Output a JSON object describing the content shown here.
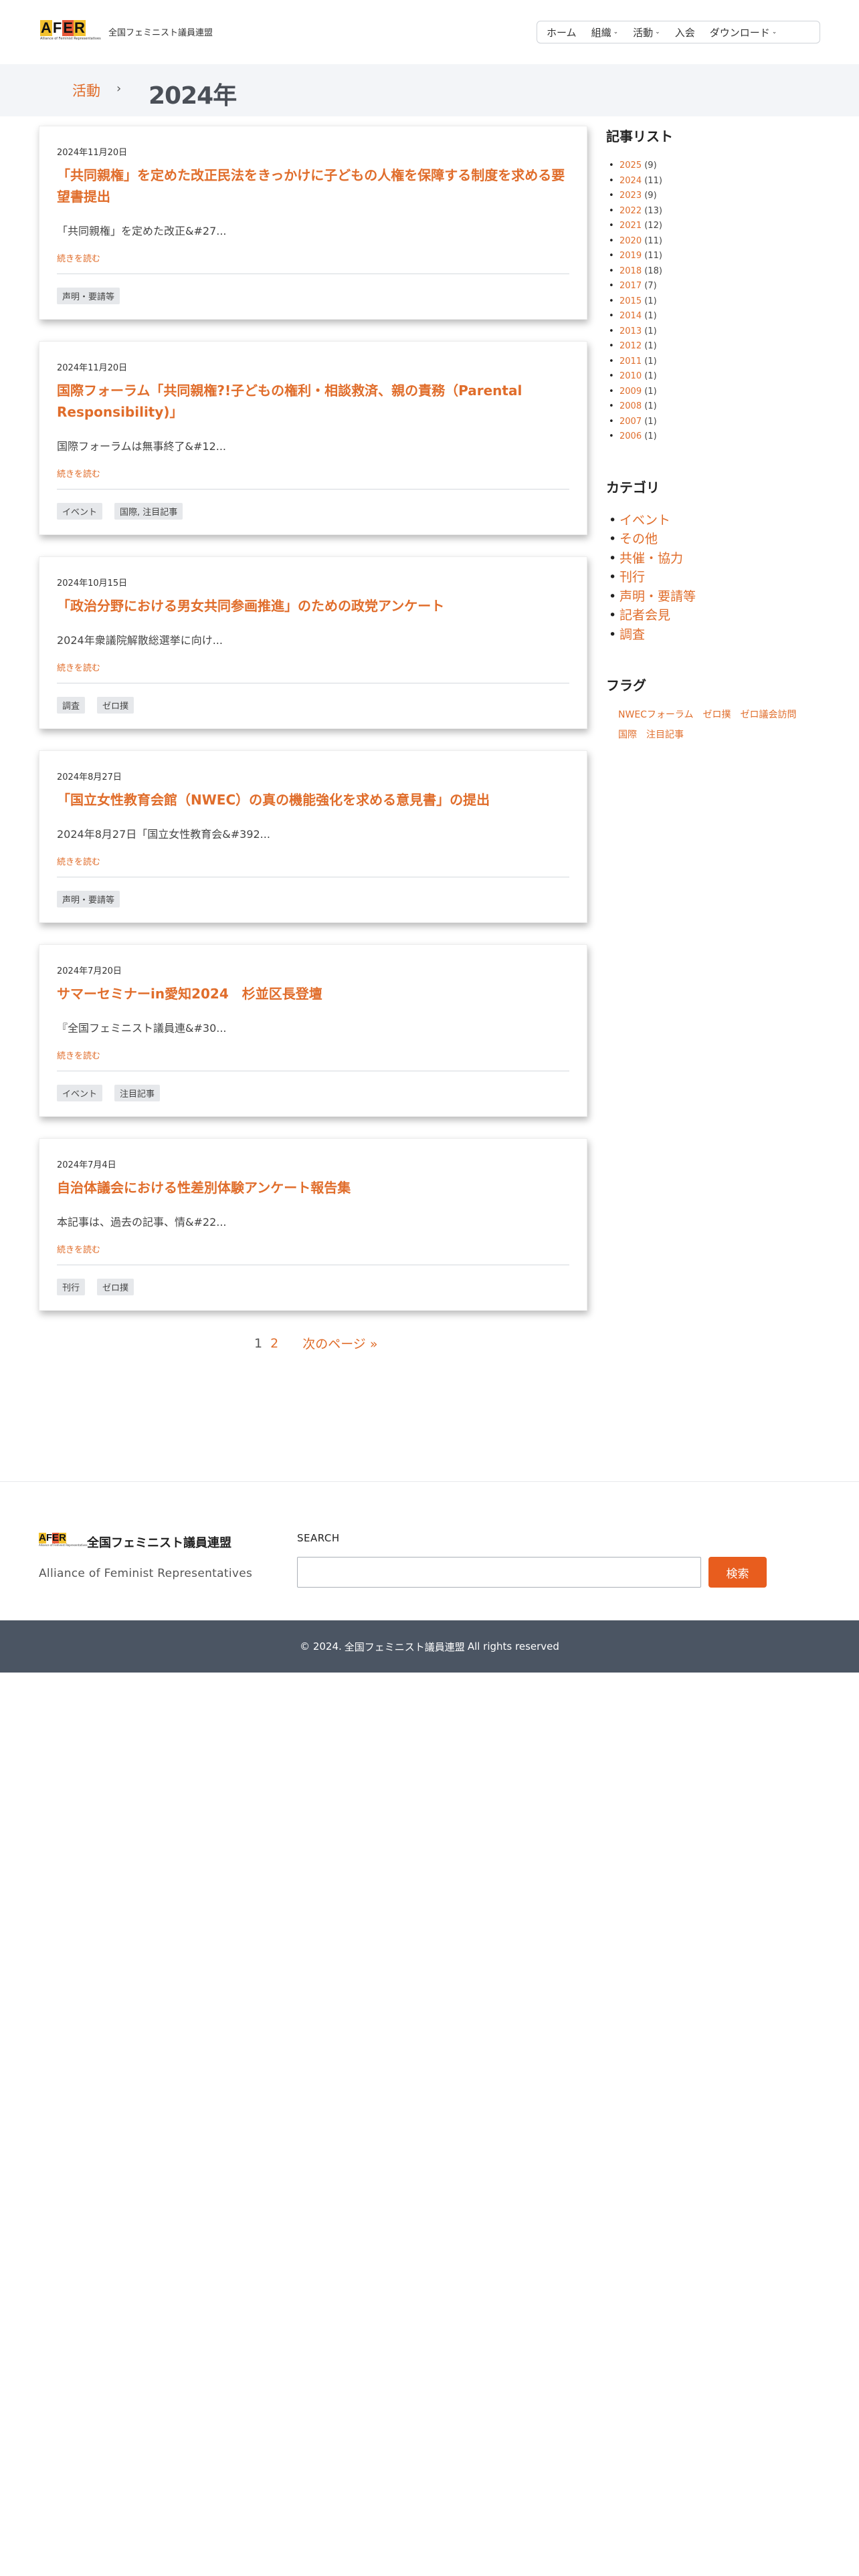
{
  "header": {
    "logo_text": [
      "A",
      "F",
      "E",
      "R"
    ],
    "logo_subtext": "Alliance of Feminist Representatives",
    "site_name": "全国フェミニスト議員連盟",
    "nav": [
      {
        "label": "ホーム",
        "has_dropdown": false
      },
      {
        "label": "組織",
        "has_dropdown": true
      },
      {
        "label": "活動",
        "has_dropdown": true
      },
      {
        "label": "入会",
        "has_dropdown": false
      },
      {
        "label": "ダウンロード",
        "has_dropdown": true
      }
    ]
  },
  "breadcrumb": {
    "parent": "活動",
    "separator": "›",
    "current": "2024年"
  },
  "posts": [
    {
      "date": "2024年11月20日",
      "title": "「共同親権」を定めた改正民法をきっかけに子どもの人権を保障する制度を求める要望書提出",
      "excerpt": "「共同親権」を定めた改正&#27...",
      "read_more": "続きを読む",
      "tags": [
        "声明・要請等"
      ]
    },
    {
      "date": "2024年11月20日",
      "title": "国際フォーラム「共同親権?!子どもの権利・相談救済、親の責務（Parental Responsibility)」",
      "excerpt": "国際フォーラムは無事終了&#12...",
      "read_more": "続きを読む",
      "tags": [
        "イベント",
        "国際, 注目記事"
      ]
    },
    {
      "date": "2024年10月15日",
      "title": "「政治分野における男女共同参画推進」のための政党アンケート",
      "excerpt": "2024年衆議院解散総選挙に向け...",
      "read_more": "続きを読む",
      "tags": [
        "調査",
        "ゼロ撲"
      ]
    },
    {
      "date": "2024年8月27日",
      "title": "「国立女性教育会館（NWEC）の真の機能強化を求める意見書」の提出",
      "excerpt": "2024年8月27日「国立女性教育会&#392...",
      "read_more": "続きを読む",
      "tags": [
        "声明・要請等"
      ]
    },
    {
      "date": "2024年7月20日",
      "title": "サマーセミナーin愛知2024　杉並区長登壇",
      "excerpt": "『全国フェミニスト議員連&#30...",
      "read_more": "続きを読む",
      "tags": [
        "イベント",
        "注目記事"
      ]
    },
    {
      "date": "2024年7月4日",
      "title": "自治体議会における性差別体験アンケート報告集",
      "excerpt": "本記事は、過去の記事、情&#22...",
      "read_more": "続きを読む",
      "tags": [
        "刊行",
        "ゼロ撲"
      ]
    }
  ],
  "pagination": {
    "current": "1",
    "pages": [
      "2"
    ],
    "next": "次のページ »"
  },
  "sidebar": {
    "archive_title": "記事リスト",
    "archives": [
      {
        "year": "2025",
        "count": "(9)"
      },
      {
        "year": "2024",
        "count": "(11)"
      },
      {
        "year": "2023",
        "count": "(9)"
      },
      {
        "year": "2022",
        "count": "(13)"
      },
      {
        "year": "2021",
        "count": "(12)"
      },
      {
        "year": "2020",
        "count": "(11)"
      },
      {
        "year": "2019",
        "count": "(11)"
      },
      {
        "year": "2018",
        "count": "(18)"
      },
      {
        "year": "2017",
        "count": "(7)"
      },
      {
        "year": "2015",
        "count": "(1)"
      },
      {
        "year": "2014",
        "count": "(1)"
      },
      {
        "year": "2013",
        "count": "(1)"
      },
      {
        "year": "2012",
        "count": "(1)"
      },
      {
        "year": "2011",
        "count": "(1)"
      },
      {
        "year": "2010",
        "count": "(1)"
      },
      {
        "year": "2009",
        "count": "(1)"
      },
      {
        "year": "2008",
        "count": "(1)"
      },
      {
        "year": "2007",
        "count": "(1)"
      },
      {
        "year": "2006",
        "count": "(1)"
      }
    ],
    "category_title": "カテゴリ",
    "categories": [
      "イベント",
      "その他",
      "共催・協力",
      "刊行",
      "声明・要請等",
      "記者会見",
      "調査"
    ],
    "tag_title": "フラグ",
    "tag_cloud": [
      "NWECフォーラム",
      "ゼロ撲",
      "ゼロ議会訪問",
      "国際",
      "注目記事"
    ]
  },
  "footer": {
    "org_name": "全国フェミニスト議員連盟",
    "tagline": "Alliance of Feminist Representatives",
    "search_label": "SEARCH",
    "search_placeholder": "",
    "search_button": "検索",
    "copyright_prefix": "© 2024.",
    "copyright_name": "全国フェミニスト議員連盟",
    "copyright_suffix": "All rights reserved"
  },
  "colors": {
    "accent": "#e06d2b",
    "button": "#e85d1e",
    "footer_bar": "#4b5563",
    "breadcrumb_bg": "#f3f5f8"
  }
}
